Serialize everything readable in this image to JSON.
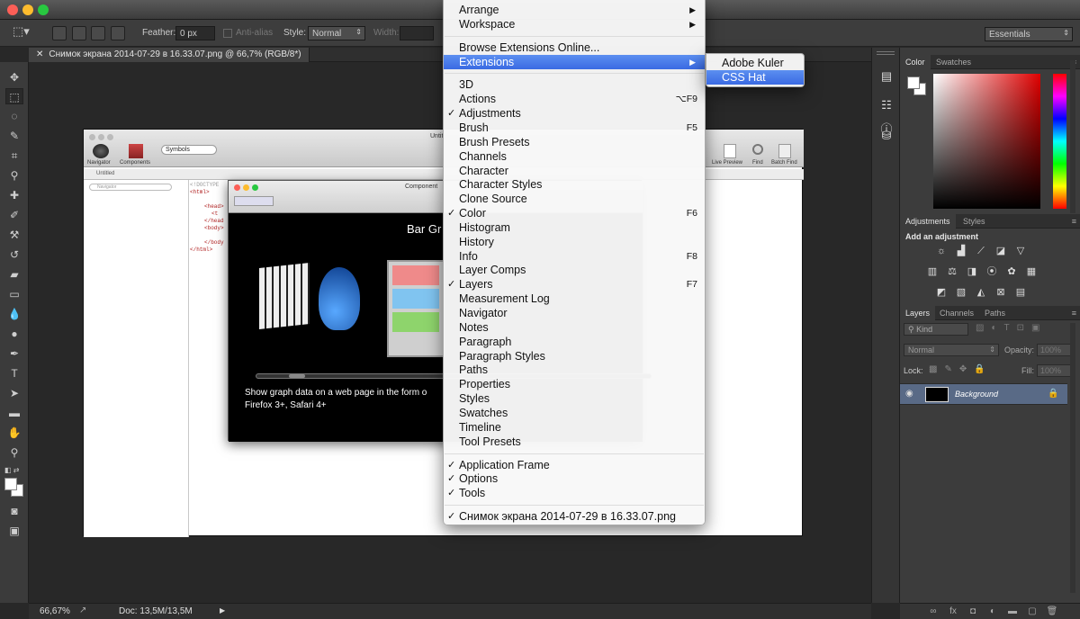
{
  "options_bar": {
    "feather_label": "Feather:",
    "feather_value": "0 px",
    "antialias_label": "Anti-alias",
    "style_label": "Style:",
    "style_value": "Normal",
    "width_label": "Width:",
    "workspace_value": "Essentials"
  },
  "document_tab": {
    "title": "Снимок экрана 2014-07-29 в 16.33.07.png @ 66,7% (RGB/8*)"
  },
  "canvas_content": {
    "ide_title": "Untit",
    "ide_toolbar": [
      "Navigator",
      "Components",
      "Symbols"
    ],
    "ide_right_buttons": [
      "Live Preview",
      "Find",
      "Batch Find"
    ],
    "ide_tab": "Untitled",
    "ide_search_placeholder": "Navigator",
    "code_lines": [
      "<!DOCTYPE",
      "<html>",
      "",
      "<head>",
      "<t",
      "</head",
      "<body>",
      "",
      "</body",
      "</html>"
    ],
    "component_window_title": "Component",
    "component_heading": "Bar Gr",
    "component_desc_line1": "Show graph data on a web page in the form o",
    "component_desc_line2": "Firefox 3+, Safari 4+"
  },
  "window_menu": {
    "items": [
      {
        "label": "Arrange",
        "submenu": true
      },
      {
        "label": "Workspace",
        "submenu": true
      },
      {
        "separator": true
      },
      {
        "label": "Browse Extensions Online..."
      },
      {
        "label": "Extensions",
        "submenu": true,
        "highlighted": true
      },
      {
        "separator": true
      },
      {
        "label": "3D"
      },
      {
        "label": "Actions",
        "shortcut": "⌥F9"
      },
      {
        "label": "Adjustments",
        "checked": true
      },
      {
        "label": "Brush",
        "shortcut": "F5"
      },
      {
        "label": "Brush Presets"
      },
      {
        "label": "Channels"
      },
      {
        "label": "Character"
      },
      {
        "label": "Character Styles"
      },
      {
        "label": "Clone Source"
      },
      {
        "label": "Color",
        "checked": true,
        "shortcut": "F6"
      },
      {
        "label": "Histogram"
      },
      {
        "label": "History"
      },
      {
        "label": "Info",
        "shortcut": "F8"
      },
      {
        "label": "Layer Comps"
      },
      {
        "label": "Layers",
        "checked": true,
        "shortcut": "F7"
      },
      {
        "label": "Measurement Log"
      },
      {
        "label": "Navigator"
      },
      {
        "label": "Notes"
      },
      {
        "label": "Paragraph"
      },
      {
        "label": "Paragraph Styles"
      },
      {
        "label": "Paths"
      },
      {
        "label": "Properties"
      },
      {
        "label": "Styles"
      },
      {
        "label": "Swatches"
      },
      {
        "label": "Timeline"
      },
      {
        "label": "Tool Presets"
      },
      {
        "separator": true
      },
      {
        "label": "Application Frame",
        "checked": true
      },
      {
        "label": "Options",
        "checked": true
      },
      {
        "label": "Tools",
        "checked": true
      },
      {
        "separator": true
      },
      {
        "label": "Снимок экрана 2014-07-29 в 16.33.07.png",
        "checked": true
      }
    ]
  },
  "extensions_submenu": {
    "items": [
      {
        "label": "Adobe Kuler"
      },
      {
        "label": "CSS Hat",
        "highlighted": true
      }
    ]
  },
  "color_panel": {
    "tabs": [
      "Color",
      "Swatches"
    ]
  },
  "adjustments_panel": {
    "tabs": [
      "Adjustments",
      "Styles"
    ],
    "heading": "Add an adjustment"
  },
  "layers_panel": {
    "tabs": [
      "Layers",
      "Channels",
      "Paths"
    ],
    "kind_label": "Kind",
    "blend_mode": "Normal",
    "opacity_label": "Opacity:",
    "opacity_value": "100%",
    "lock_label": "Lock:",
    "fill_label": "Fill:",
    "fill_value": "100%",
    "layer_name": "Background"
  },
  "status_bar": {
    "zoom": "66,67%",
    "doc_info": "Doc: 13,5M/13,5M"
  },
  "colors": {
    "menu_highlight": "#3d6ee6",
    "ps_dark": "#3c3c3c"
  }
}
